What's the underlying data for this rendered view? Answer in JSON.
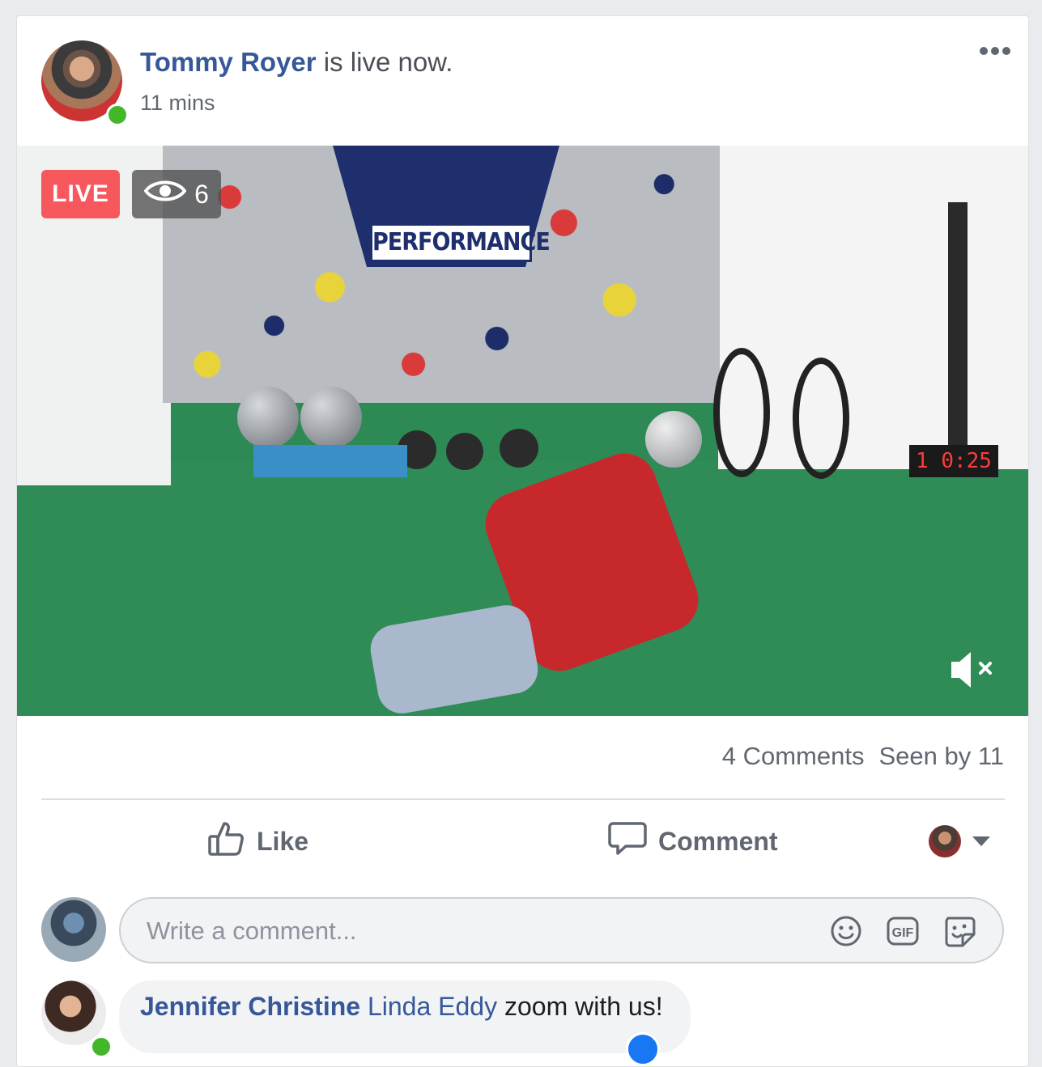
{
  "post": {
    "author": "Tommy Royer",
    "status_text": " is live now.",
    "time": "11 mins"
  },
  "video": {
    "live_label": "LIVE",
    "viewer_count": "6",
    "sign_text": "PERFORMANCE",
    "timer_text": "1 0:25"
  },
  "stats": {
    "comments": "4 Comments",
    "seen_by": "Seen by 11"
  },
  "actions": {
    "like": "Like",
    "comment": "Comment"
  },
  "composer": {
    "placeholder": "Write a comment..."
  },
  "comment": {
    "author": "Jennifer Christine",
    "tagged": "Linda Eddy",
    "text": " zoom with us!"
  },
  "colors": {
    "link": "#365899",
    "live": "#f7585e",
    "online": "#42b72a",
    "muted_text": "#606770"
  }
}
